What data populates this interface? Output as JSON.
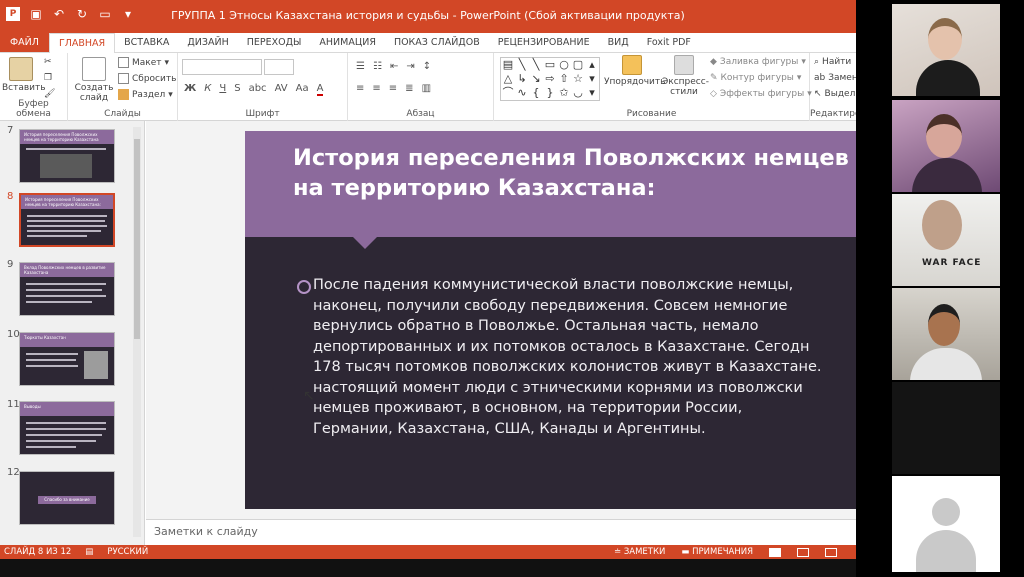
{
  "window": {
    "title": "ГРУППА 1 Этносы Казахстана история и судьбы - PowerPoint (Сбой активации продукта)"
  },
  "tabs": [
    "ФАЙЛ",
    "ГЛАВНАЯ",
    "ВСТАВКА",
    "ДИЗАЙН",
    "ПЕРЕХОДЫ",
    "АНИМАЦИЯ",
    "ПОКАЗ СЛАЙДОВ",
    "РЕЦЕНЗИРОВАНИЕ",
    "ВИД",
    "Foxit PDF"
  ],
  "active_tab": "ГЛАВНАЯ",
  "ribbon": {
    "paste": "Вставить",
    "clipboard_group": "Буфер обмена",
    "new_slide": "Создать слайд",
    "layout": "Макет",
    "reset": "Сбросить",
    "section": "Раздел",
    "slides_group": "Слайды",
    "font_group": "Шрифт",
    "font_buttons": [
      "Ж",
      "К",
      "Ч",
      "S",
      "abc",
      "AV",
      "Aa",
      "A"
    ],
    "paragraph_group": "Абзац",
    "arrange": "Упорядочить",
    "quick_styles": "Экспресс-стили",
    "shape_fill": "Заливка фигуры",
    "shape_outline": "Контур фигуры",
    "shape_effects": "Эффекты фигуры",
    "drawing_group": "Рисование",
    "find": "Найти",
    "replace": "Замен",
    "select": "Выдел",
    "editing_group": "Редактиров"
  },
  "thumbnails": [
    {
      "num": "7",
      "title": "История переселения Поволжских немцев на территорию Казахстана"
    },
    {
      "num": "8",
      "title": "История переселения Поволжских немцев на территорию Казахстана:",
      "selected": true
    },
    {
      "num": "9",
      "title": "Вклад Поволжских немцев в развитие Казахстана"
    },
    {
      "num": "10",
      "title": "Тюркоты Казахстан"
    },
    {
      "num": "11",
      "title": "Выводы"
    },
    {
      "num": "12",
      "title": "Спасибо за внимание"
    }
  ],
  "slide": {
    "title": "История переселения Поволжских немцев на территорию Казахстана:",
    "body": "  После падения коммунистической власти поволжские немцы,\nнаконец, получили свободу передвижения. Совсем немногие\nвернулись обратно в Поволжье. Остальная часть, немало\nдепортированных и их потомков осталось в Казахстане. Сегодн\n178 тысяч потомков поволжских колонистов живут в Казахстане.\nнастоящий момент люди с этническими корнями из поволжски\nнемцев проживают, в основном, на территории России,\nГермании, Казахстана, США, Канады и Аргентины."
  },
  "notes_placeholder": "Заметки к слайду",
  "status": {
    "slide_counter": "СЛАЙД 8 ИЗ 12",
    "language": "РУССКИЙ",
    "notes": "ЗАМЕТКИ",
    "comments": "ПРИМЕЧАНИЯ"
  },
  "video": {
    "badge": "WAR FACE"
  },
  "colors": {
    "accent": "#d24726",
    "slide_dark": "#2d2734",
    "slide_purple": "#8c6a9c"
  }
}
